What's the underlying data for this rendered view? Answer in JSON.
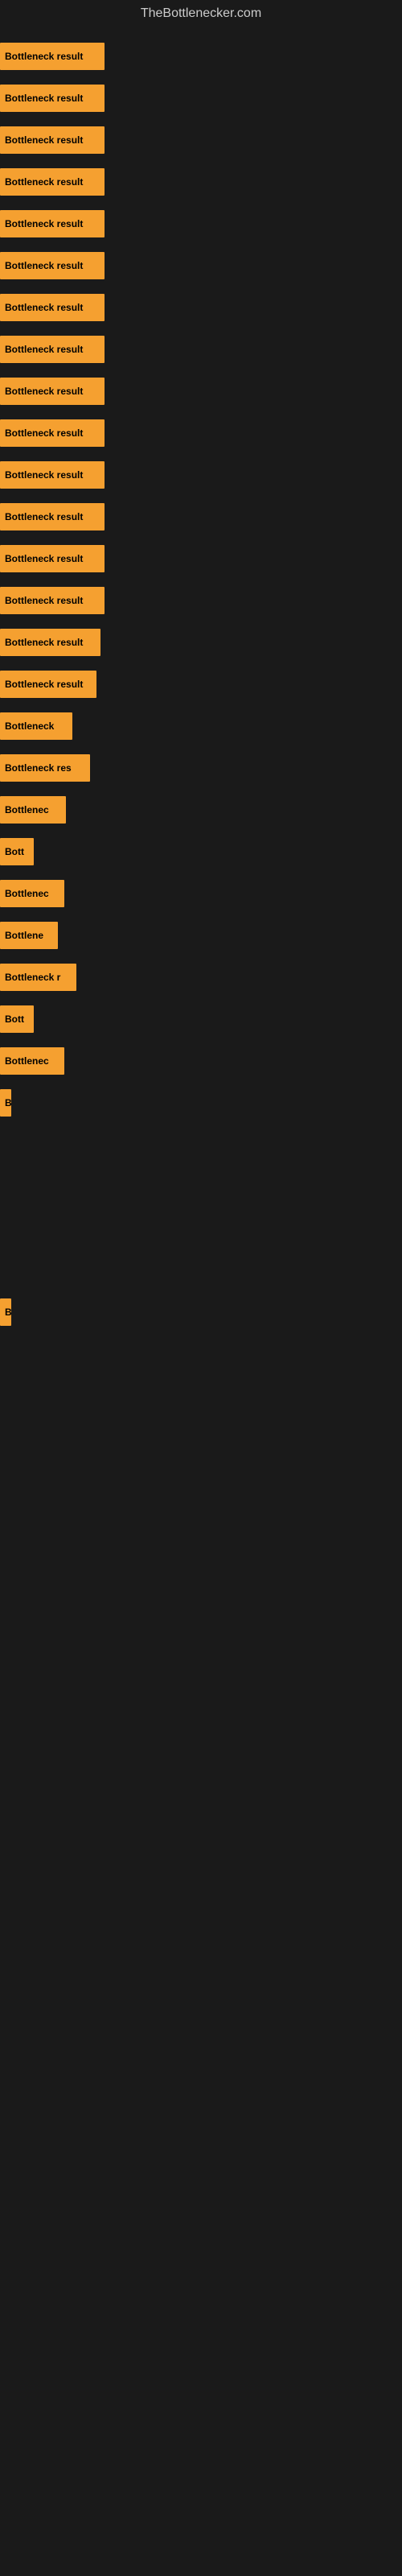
{
  "site_title": "TheBottlenecker.com",
  "bars": [
    {
      "label": "Bottleneck result",
      "width": 130
    },
    {
      "label": "Bottleneck result",
      "width": 130
    },
    {
      "label": "Bottleneck result",
      "width": 130
    },
    {
      "label": "Bottleneck result",
      "width": 130
    },
    {
      "label": "Bottleneck result",
      "width": 130
    },
    {
      "label": "Bottleneck result",
      "width": 130
    },
    {
      "label": "Bottleneck result",
      "width": 130
    },
    {
      "label": "Bottleneck result",
      "width": 130
    },
    {
      "label": "Bottleneck result",
      "width": 130
    },
    {
      "label": "Bottleneck result",
      "width": 130
    },
    {
      "label": "Bottleneck result",
      "width": 130
    },
    {
      "label": "Bottleneck result",
      "width": 130
    },
    {
      "label": "Bottleneck result",
      "width": 130
    },
    {
      "label": "Bottleneck result",
      "width": 130
    },
    {
      "label": "Bottleneck result",
      "width": 125
    },
    {
      "label": "Bottleneck result",
      "width": 120
    },
    {
      "label": "Bottleneck",
      "width": 90
    },
    {
      "label": "Bottleneck res",
      "width": 112
    },
    {
      "label": "Bottlenec",
      "width": 82
    },
    {
      "label": "Bott",
      "width": 42
    },
    {
      "label": "Bottlenec",
      "width": 80
    },
    {
      "label": "Bottlene",
      "width": 72
    },
    {
      "label": "Bottleneck r",
      "width": 95
    },
    {
      "label": "Bott",
      "width": 42
    },
    {
      "label": "Bottlenec",
      "width": 80
    },
    {
      "label": "B",
      "width": 14
    },
    {
      "label": "",
      "width": 0
    },
    {
      "label": "",
      "width": 0
    },
    {
      "label": "",
      "width": 0
    },
    {
      "label": "",
      "width": 0
    },
    {
      "label": "B",
      "width": 14
    },
    {
      "label": "",
      "width": 0
    },
    {
      "label": "",
      "width": 0
    },
    {
      "label": "",
      "width": 0
    },
    {
      "label": "",
      "width": 0
    },
    {
      "label": "",
      "width": 0
    },
    {
      "label": "",
      "width": 0
    },
    {
      "label": "",
      "width": 0
    },
    {
      "label": "",
      "width": 0
    },
    {
      "label": "",
      "width": 0
    }
  ]
}
